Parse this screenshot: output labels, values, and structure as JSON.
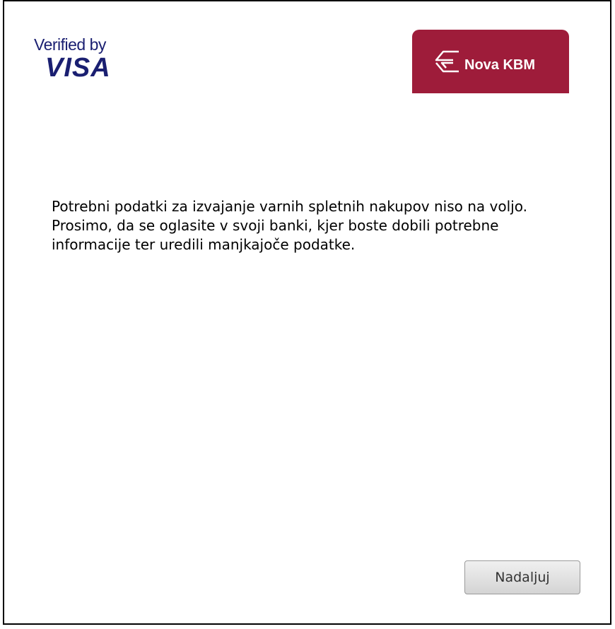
{
  "header": {
    "visa_logo": {
      "line1": "Verified by",
      "line2": "VISA",
      "color": "#1a1f71"
    },
    "bank_logo": {
      "name": "Nova KBM",
      "background": "#9e1c3a",
      "icon": "nkbm-arrow-emblem-icon"
    }
  },
  "main": {
    "message": "Potrebni podatki za izvajanje varnih spletnih nakupov niso na voljo. Prosimo, da se oglasite v svoji banki, kjer boste dobili potrebne informacije ter uredili manjkajoče podatke."
  },
  "footer": {
    "continue_label": "Nadaljuj"
  }
}
